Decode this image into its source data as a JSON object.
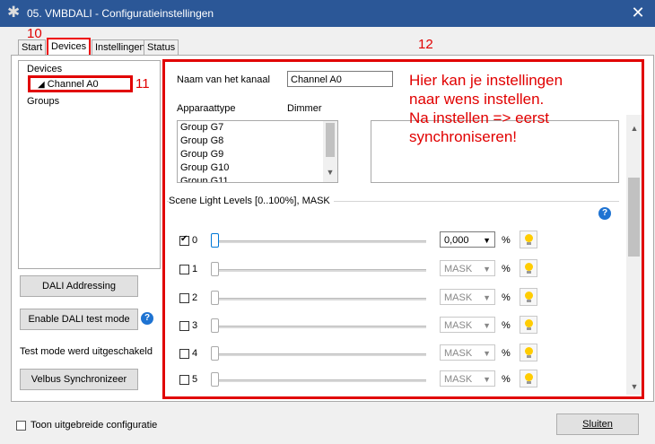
{
  "window": {
    "title": "05. VMBDALI - Configuratieinstellingen",
    "close_label": "✕"
  },
  "tabs": [
    {
      "label": "Start"
    },
    {
      "label": "Devices"
    },
    {
      "label": "Instellingen"
    },
    {
      "label": "Status"
    }
  ],
  "tree": {
    "root": "Devices",
    "child": "Channel A0",
    "groups": "Groups"
  },
  "annotations": {
    "n10": "10",
    "n11": "11",
    "n12": "12",
    "note_line1": "Hier kan je instellingen",
    "note_line2": "naar wens instellen.",
    "note_line3": "Na instellen => eerst",
    "note_line4": "synchroniseren!"
  },
  "left_buttons": {
    "dali_addressing": "DALI Addressing",
    "enable_test_mode": "Enable DALI test mode",
    "test_mode_status": "Test mode werd uitgeschakeld",
    "velbus_sync": "Velbus Synchronizeer"
  },
  "channel": {
    "name_label": "Naam van het kanaal",
    "name_value": "Channel A0",
    "type_label": "Apparaattype",
    "type_value": "Dimmer",
    "groups_list": [
      "Group G7",
      "Group G8",
      "Group G9",
      "Group G10",
      "Group G11"
    ]
  },
  "scenes": {
    "header": "Scene Light Levels [0..100%], MASK",
    "percent": "%",
    "rows": [
      {
        "index": "0",
        "checked": true,
        "value": "0,000"
      },
      {
        "index": "1",
        "checked": false,
        "value": "MASK"
      },
      {
        "index": "2",
        "checked": false,
        "value": "MASK"
      },
      {
        "index": "3",
        "checked": false,
        "value": "MASK"
      },
      {
        "index": "4",
        "checked": false,
        "value": "MASK"
      },
      {
        "index": "5",
        "checked": false,
        "value": "MASK"
      }
    ]
  },
  "footer": {
    "extended_config": "Toon uitgebreide configuratie",
    "close_button": "Sluiten"
  },
  "colors": {
    "titlebar": "#2b5797",
    "annotation_red": "#e10000",
    "help_blue": "#1e73d2"
  }
}
